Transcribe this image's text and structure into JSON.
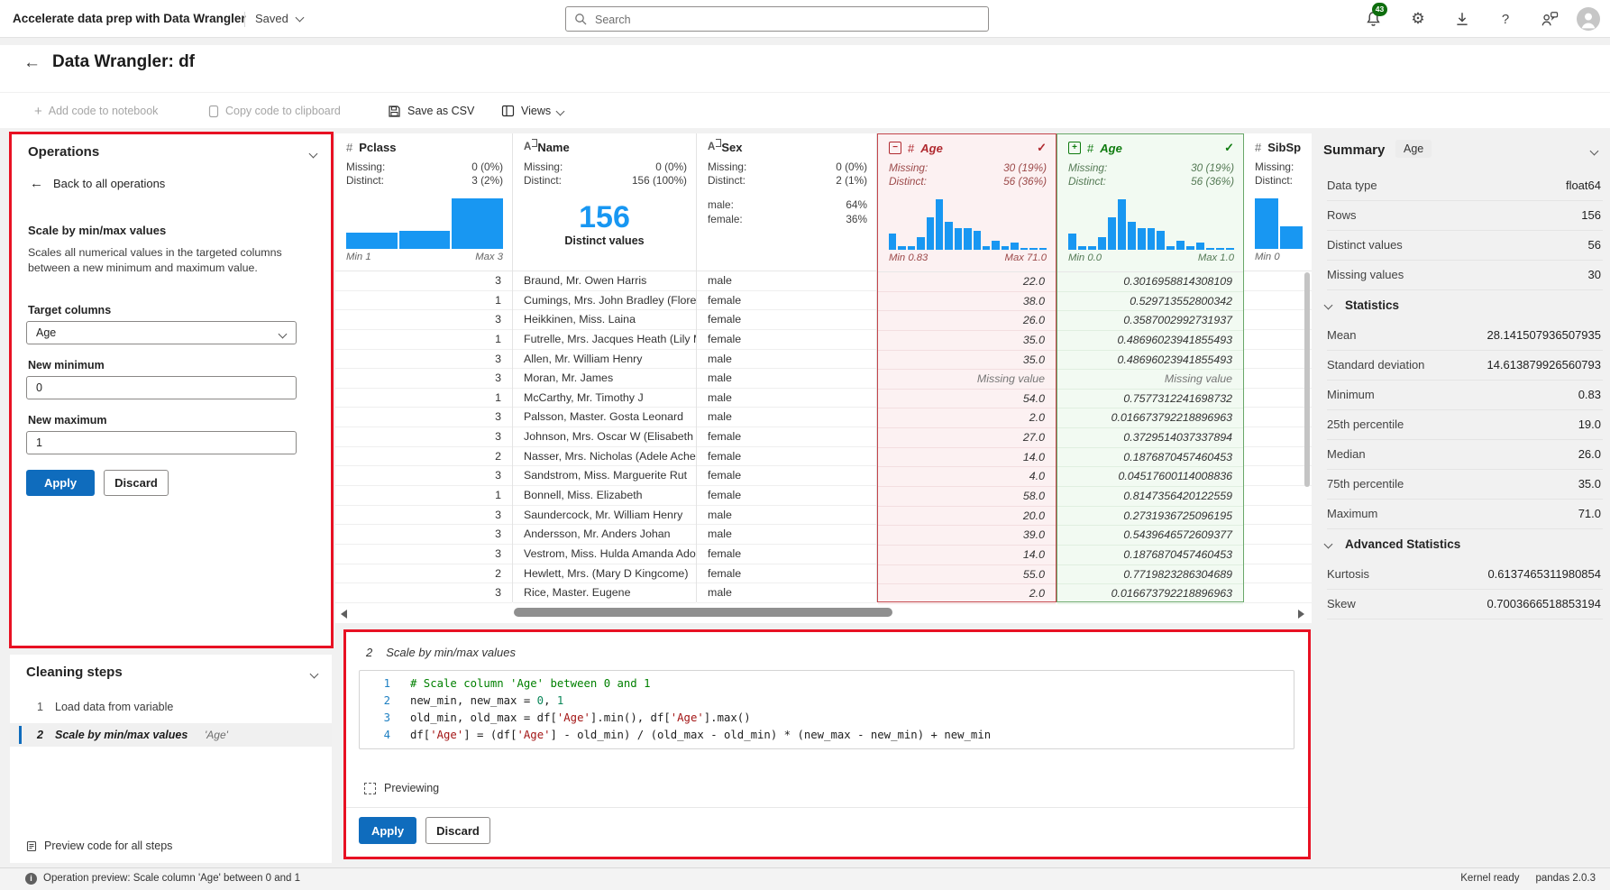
{
  "top_bar": {
    "app_title": "Accelerate data prep with Data Wrangler",
    "saved_label": "Saved",
    "search_placeholder": "Search",
    "notification_count": "43"
  },
  "header": {
    "title": "Data Wrangler: df"
  },
  "toolbar": {
    "add_code": "Add code to notebook",
    "copy_code": "Copy code to clipboard",
    "save_csv": "Save as CSV",
    "views": "Views"
  },
  "operations": {
    "title": "Operations",
    "back": "Back to all operations",
    "op_name": "Scale by min/max values",
    "description": "Scales all numerical values in the targeted columns between a new minimum and maximum value.",
    "target_label": "Target columns",
    "target_value": "Age",
    "min_label": "New minimum",
    "min_value": "0",
    "max_label": "New maximum",
    "max_value": "1",
    "apply": "Apply",
    "discard": "Discard"
  },
  "cleaning": {
    "title": "Cleaning steps",
    "steps": [
      {
        "num": "1",
        "label": "Load data from variable",
        "arg": ""
      },
      {
        "num": "2",
        "label": "Scale by min/max values",
        "arg": "'Age'"
      }
    ],
    "preview_all": "Preview code for all steps"
  },
  "grid": {
    "missing_text": "Missing value",
    "columns": [
      {
        "name": "Pclass",
        "icon": "number-icon",
        "missing_label": "Missing:",
        "missing": "0 (0%)",
        "distinct_label": "Distinct:",
        "distinct": "3 (2%)",
        "hist": {
          "bars": [
            0.33,
            0.35,
            1
          ],
          "min": "Min 1",
          "max": "Max 3"
        }
      },
      {
        "name": "Name",
        "icon": "text-icon",
        "missing_label": "Missing:",
        "missing": "0 (0%)",
        "distinct_label": "Distinct:",
        "distinct": "156 (100%)",
        "big_value": "156",
        "big_label": "Distinct values"
      },
      {
        "name": "Sex",
        "icon": "text-icon",
        "missing_label": "Missing:",
        "missing": "0 (0%)",
        "distinct_label": "Distinct:",
        "distinct": "2 (1%)",
        "categories": [
          {
            "label": "male:",
            "value": "64%"
          },
          {
            "label": "female:",
            "value": "36%"
          }
        ]
      },
      {
        "name": "Age",
        "icon": "number-icon",
        "variant": "removed",
        "box_glyph": "−",
        "check_glyph": "✓",
        "missing_label": "Missing:",
        "missing": "30 (19%)",
        "distinct_label": "Distinct:",
        "distinct": "56 (36%)",
        "hist": {
          "bars": [
            0.32,
            0.07,
            0.07,
            0.25,
            0.65,
            1,
            0.55,
            0.42,
            0.43,
            0.37,
            0.08,
            0.18,
            0.08,
            0.15,
            0.03,
            0.03,
            0.04
          ],
          "min": "Min 0.83",
          "max": "Max 71.0"
        }
      },
      {
        "name": "Age",
        "icon": "number-icon",
        "variant": "added",
        "box_glyph": "+",
        "check_glyph": "✓",
        "missing_label": "Missing:",
        "missing": "30 (19%)",
        "distinct_label": "Distinct:",
        "distinct": "56 (36%)",
        "hist": {
          "bars": [
            0.32,
            0.07,
            0.07,
            0.25,
            0.65,
            1,
            0.55,
            0.42,
            0.43,
            0.37,
            0.08,
            0.18,
            0.08,
            0.15,
            0.03,
            0.03,
            0.04
          ],
          "min": "Min 0.0",
          "max": "Max 1.0"
        }
      },
      {
        "name": "SibSp",
        "icon": "number-icon",
        "missing_label": "Missing:",
        "missing": "",
        "distinct_label": "Distinct:",
        "distinct": "",
        "hist": {
          "bars": [
            1,
            0.45
          ],
          "min": "Min 0",
          "max": ""
        }
      }
    ],
    "rows": [
      {
        "pclass": "3",
        "name": "Braund, Mr. Owen Harris",
        "sex": "male",
        "age": "22.0",
        "scaled": "0.3016958814308109"
      },
      {
        "pclass": "1",
        "name": "Cumings, Mrs. John Bradley (Florenc",
        "sex": "female",
        "age": "38.0",
        "scaled": "0.529713552800342"
      },
      {
        "pclass": "3",
        "name": "Heikkinen, Miss. Laina",
        "sex": "female",
        "age": "26.0",
        "scaled": "0.3587002992731937"
      },
      {
        "pclass": "1",
        "name": "Futrelle, Mrs. Jacques Heath (Lily Ma",
        "sex": "female",
        "age": "35.0",
        "scaled": "0.48696023941855493"
      },
      {
        "pclass": "3",
        "name": "Allen, Mr. William Henry",
        "sex": "male",
        "age": "35.0",
        "scaled": "0.48696023941855493"
      },
      {
        "pclass": "3",
        "name": "Moran, Mr. James",
        "sex": "male",
        "age": "Missing value",
        "scaled": "Missing value"
      },
      {
        "pclass": "1",
        "name": "McCarthy, Mr. Timothy J",
        "sex": "male",
        "age": "54.0",
        "scaled": "0.7577312241698732"
      },
      {
        "pclass": "3",
        "name": "Palsson, Master. Gosta Leonard",
        "sex": "male",
        "age": "2.0",
        "scaled": "0.016673792218896963"
      },
      {
        "pclass": "3",
        "name": "Johnson, Mrs. Oscar W (Elisabeth Vil",
        "sex": "female",
        "age": "27.0",
        "scaled": "0.3729514037337894"
      },
      {
        "pclass": "2",
        "name": "Nasser, Mrs. Nicholas (Adele Achem",
        "sex": "female",
        "age": "14.0",
        "scaled": "0.1876870457460453"
      },
      {
        "pclass": "3",
        "name": "Sandstrom, Miss. Marguerite Rut",
        "sex": "female",
        "age": "4.0",
        "scaled": "0.04517600114008836"
      },
      {
        "pclass": "1",
        "name": "Bonnell, Miss. Elizabeth",
        "sex": "female",
        "age": "58.0",
        "scaled": "0.8147356420122559"
      },
      {
        "pclass": "3",
        "name": "Saundercock, Mr. William Henry",
        "sex": "male",
        "age": "20.0",
        "scaled": "0.2731936725096195"
      },
      {
        "pclass": "3",
        "name": "Andersson, Mr. Anders Johan",
        "sex": "male",
        "age": "39.0",
        "scaled": "0.5439646572609377"
      },
      {
        "pclass": "3",
        "name": "Vestrom, Miss. Hulda Amanda Adolf",
        "sex": "female",
        "age": "14.0",
        "scaled": "0.1876870457460453"
      },
      {
        "pclass": "2",
        "name": "Hewlett, Mrs. (Mary D Kingcome)",
        "sex": "female",
        "age": "55.0",
        "scaled": "0.7719823286304689"
      },
      {
        "pclass": "3",
        "name": "Rice, Master. Eugene",
        "sex": "male",
        "age": "2.0",
        "scaled": "0.016673792218896963"
      }
    ]
  },
  "code_panel": {
    "step_num": "2",
    "step_label": "Scale by min/max values",
    "lines": [
      [
        {
          "c": "comment",
          "t": "# Scale column 'Age' between 0 and 1"
        }
      ],
      [
        {
          "c": "plain",
          "t": "new_min, new_max = "
        },
        {
          "c": "num",
          "t": "0"
        },
        {
          "c": "plain",
          "t": ", "
        },
        {
          "c": "num",
          "t": "1"
        }
      ],
      [
        {
          "c": "plain",
          "t": "old_min, old_max = df["
        },
        {
          "c": "str",
          "t": "'Age'"
        },
        {
          "c": "plain",
          "t": "].min(), df["
        },
        {
          "c": "str",
          "t": "'Age'"
        },
        {
          "c": "plain",
          "t": "].max()"
        }
      ],
      [
        {
          "c": "plain",
          "t": "df["
        },
        {
          "c": "str",
          "t": "'Age'"
        },
        {
          "c": "plain",
          "t": "] = (df["
        },
        {
          "c": "str",
          "t": "'Age'"
        },
        {
          "c": "plain",
          "t": "] - old_min) / (old_max - old_min) * (new_max - new_min) + new_min"
        }
      ]
    ],
    "previewing": "Previewing",
    "apply": "Apply",
    "discard": "Discard"
  },
  "summary": {
    "title": "Summary",
    "badge": "Age",
    "rows": [
      {
        "label": "Data type",
        "value": "float64"
      },
      {
        "label": "Rows",
        "value": "156"
      },
      {
        "label": "Distinct values",
        "value": "56"
      },
      {
        "label": "Missing values",
        "value": "30"
      }
    ],
    "statistics_title": "Statistics",
    "statistics": [
      {
        "label": "Mean",
        "value": "28.141507936507935"
      },
      {
        "label": "Standard deviation",
        "value": "14.613879926560793"
      },
      {
        "label": "Minimum",
        "value": "0.83"
      },
      {
        "label": "25th percentile",
        "value": "19.0"
      },
      {
        "label": "Median",
        "value": "26.0"
      },
      {
        "label": "75th percentile",
        "value": "35.0"
      },
      {
        "label": "Maximum",
        "value": "71.0"
      }
    ],
    "advanced_title": "Advanced Statistics",
    "advanced": [
      {
        "label": "Kurtosis",
        "value": "0.6137465311980854"
      },
      {
        "label": "Skew",
        "value": "0.7003666518853194"
      }
    ]
  },
  "status_bar": {
    "message": "Operation preview: Scale column 'Age' between 0 and 1",
    "kernel": "Kernel ready",
    "pandas": "pandas 2.0.3"
  },
  "colors": {
    "accent": "#0f6cbd",
    "histogram": "#1897f2",
    "removed_column": "#b02a30",
    "added_column": "#107c10",
    "annotation": "#e81123",
    "badge_green": "#0e6e0e"
  }
}
